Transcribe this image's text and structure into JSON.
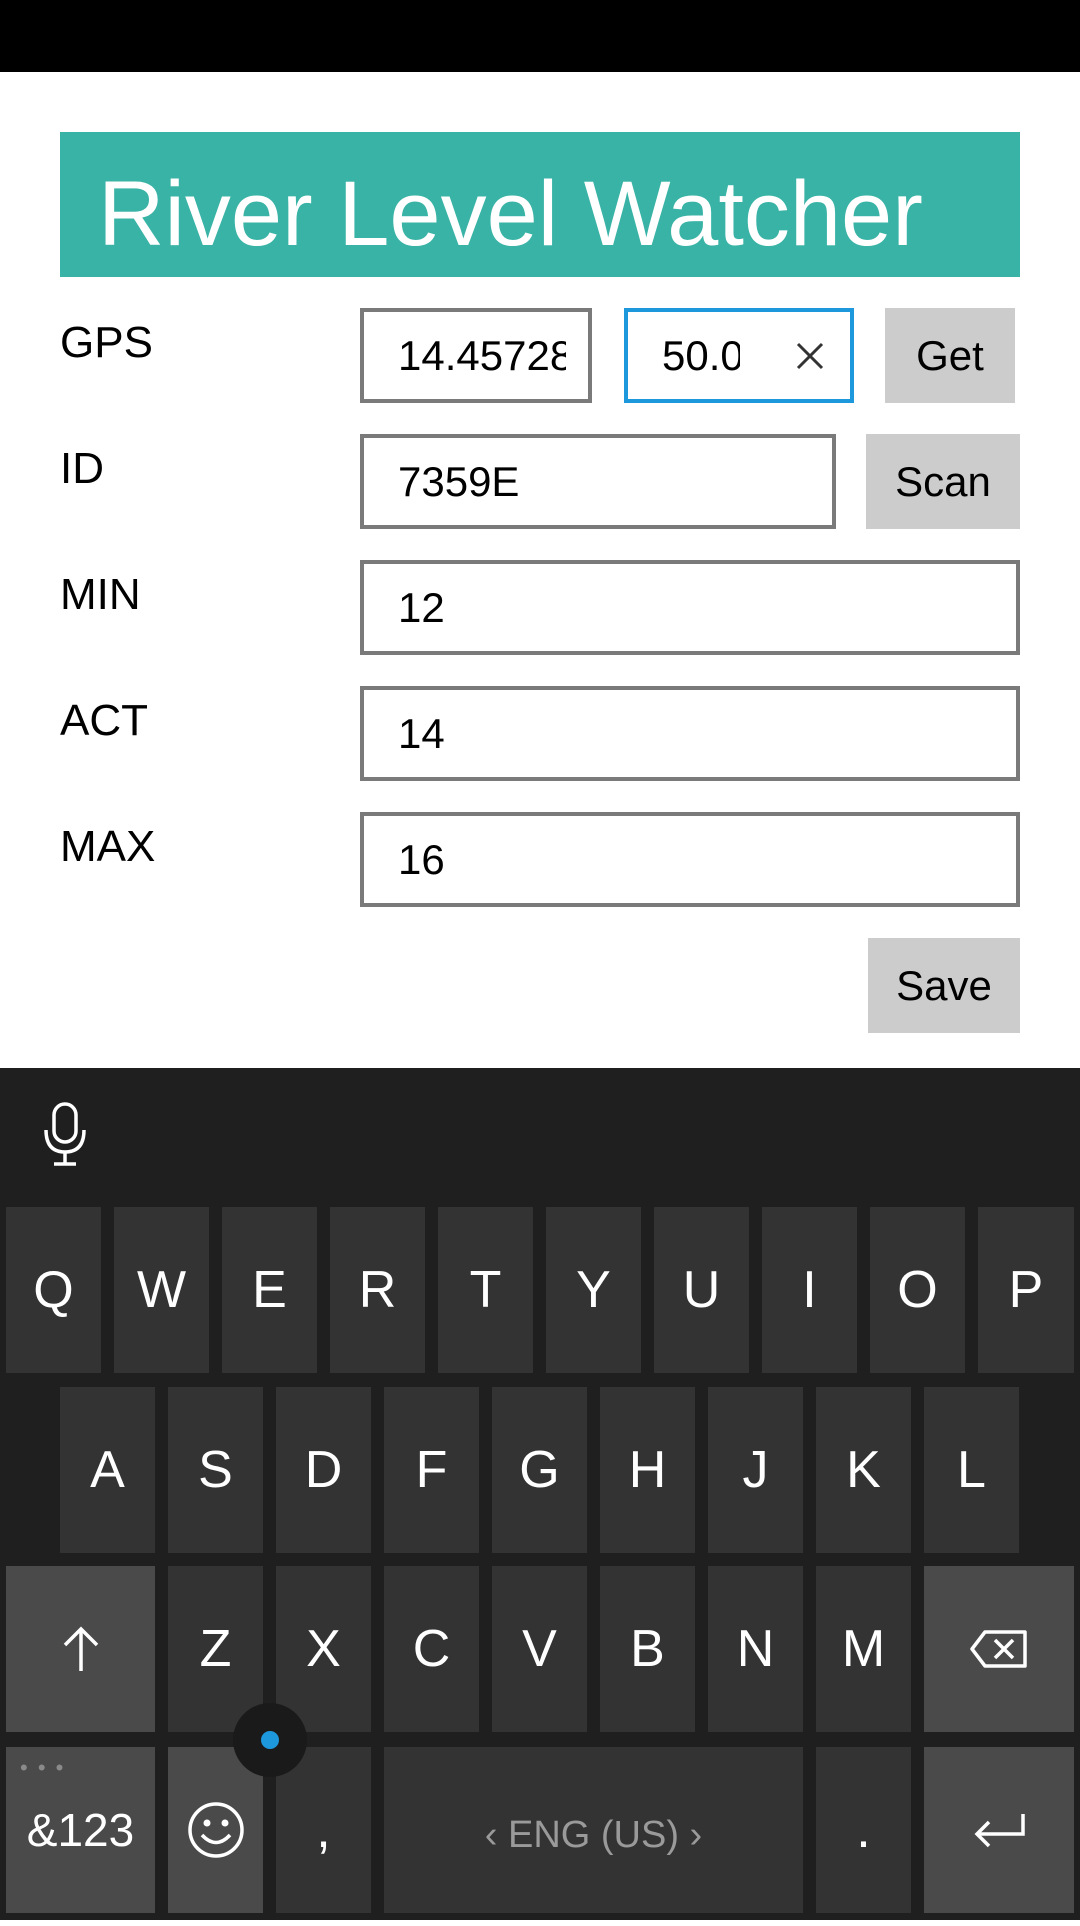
{
  "app": {
    "title": "River Level Watcher"
  },
  "form": {
    "gps": {
      "label": "GPS",
      "lat_value": "14.45728",
      "lon_value": "50.0",
      "get_button": "Get"
    },
    "id": {
      "label": "ID",
      "value": "7359E",
      "scan_button": "Scan"
    },
    "min": {
      "label": "MIN",
      "value": "12"
    },
    "act": {
      "label": "ACT",
      "value": "14"
    },
    "max": {
      "label": "MAX",
      "value": "16"
    },
    "save_button": "Save"
  },
  "keyboard": {
    "row1": [
      "Q",
      "W",
      "E",
      "R",
      "T",
      "Y",
      "U",
      "I",
      "O",
      "P"
    ],
    "row2": [
      "A",
      "S",
      "D",
      "F",
      "G",
      "H",
      "J",
      "K",
      "L"
    ],
    "row3": [
      "Z",
      "X",
      "C",
      "V",
      "B",
      "N",
      "M"
    ],
    "symbols_key": "&123",
    "comma_key": ",",
    "space_label": "‹ ENG (US) ›",
    "period_key": "."
  },
  "colors": {
    "accent": "#38b3a6",
    "focus": "#1e98dc"
  }
}
